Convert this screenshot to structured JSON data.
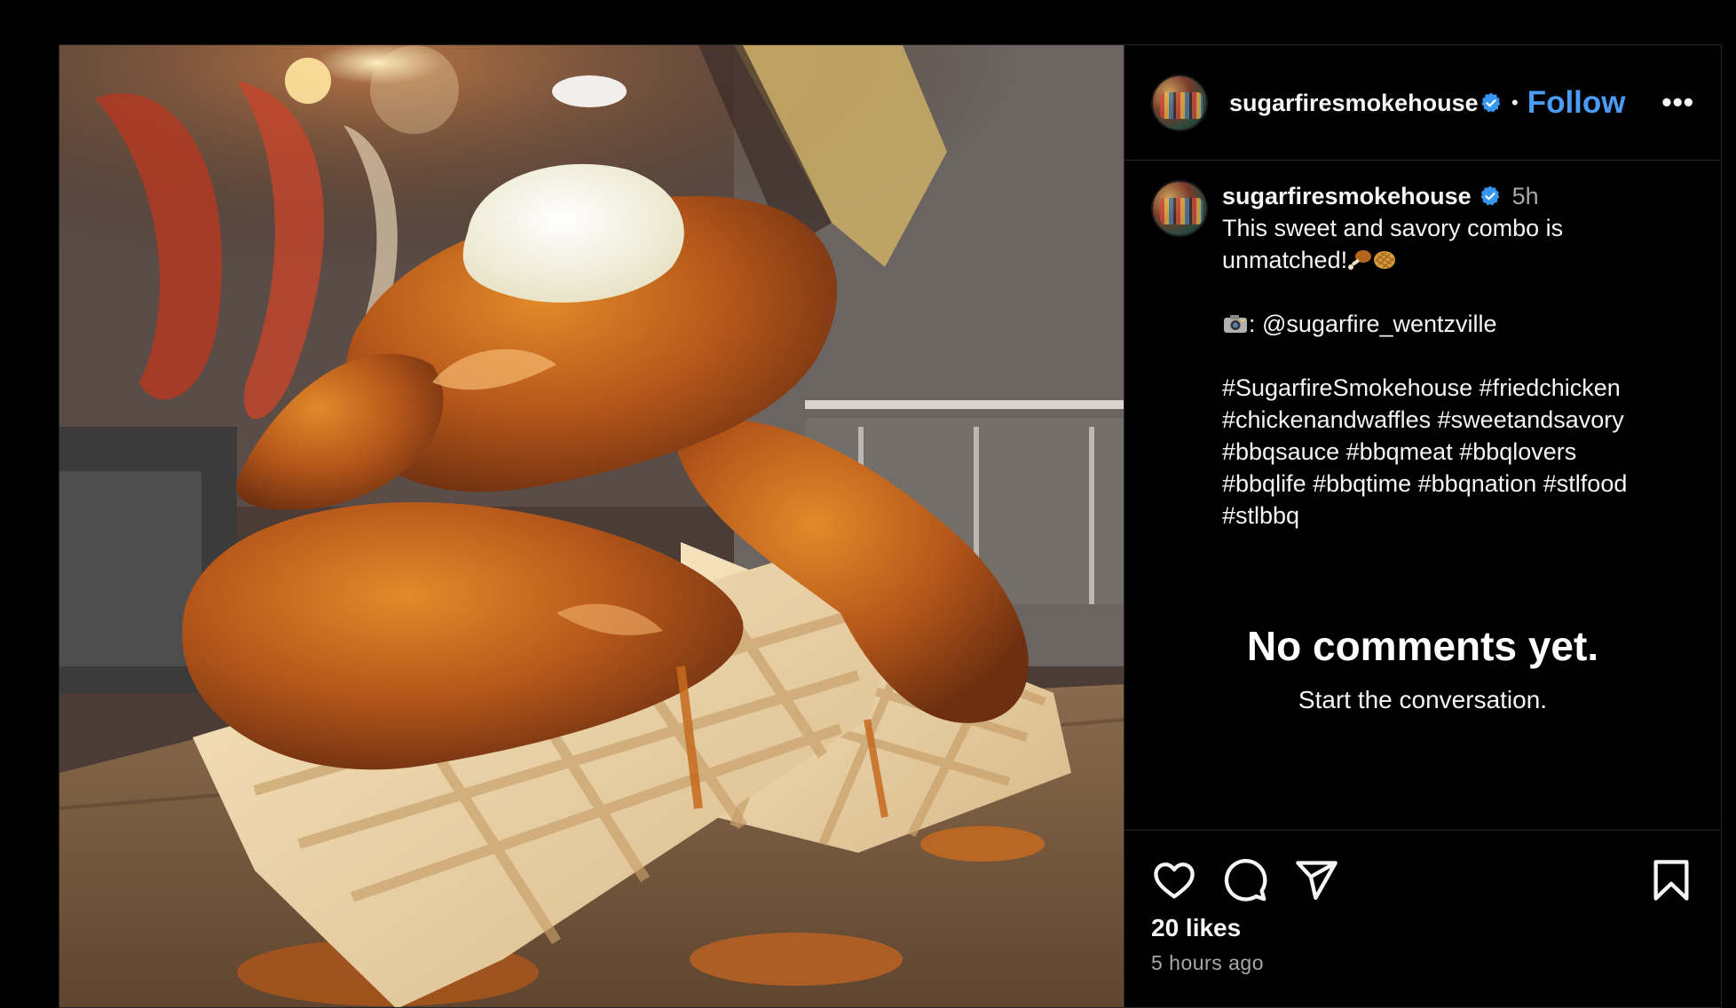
{
  "post": {
    "image_alt": "fried chicken tenders with orange sauce and butter on waffles",
    "header": {
      "username": "sugarfiresmokehouse",
      "separator": "•",
      "follow_label": "Follow",
      "more_label": "•••"
    },
    "caption": {
      "username": "sugarfiresmokehouse",
      "time": "5h",
      "line1": "This sweet and savory combo is unmatched!",
      "credit": ": @sugarfire_wentzville",
      "hashtags": "#SugarfireSmokehouse #friedchicken\n#chickenandwaffles #sweetandsavory\n#bbqsauce #bbqmeat #bbqlovers\n#bbqlife #bbqtime #bbqnation #stlfood\n#stlbbq"
    },
    "comments": {
      "empty_title": "No comments yet.",
      "empty_subtitle": "Start the conversation."
    },
    "footer": {
      "likes": "20 likes",
      "time_ago": "5 hours ago"
    },
    "icons": [
      "heart-icon",
      "comment-icon",
      "share-icon",
      "bookmark-icon",
      "verified-icon",
      "more-icon"
    ],
    "colors": {
      "background": "#000000",
      "follow": "#4a9cf4",
      "verified": "#3797f0",
      "muted": "#a8a8a8",
      "divider": "#262626"
    }
  }
}
